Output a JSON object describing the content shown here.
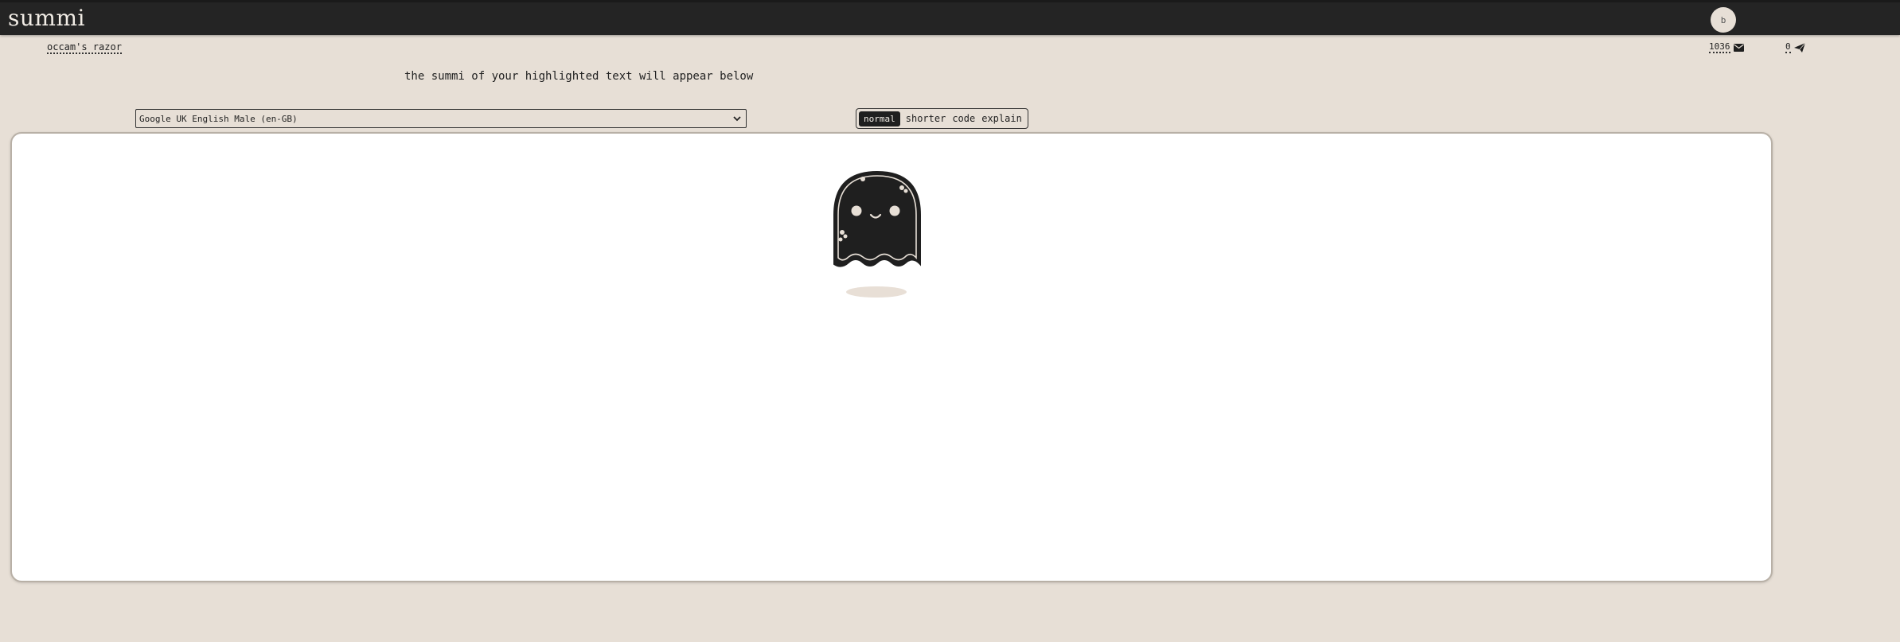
{
  "app": {
    "brand": "summi",
    "avatar_initial": "b"
  },
  "header_links": {
    "occam": "occam's razor",
    "mail_count": "1036",
    "send_count": "0"
  },
  "instructions": "the summi of your highlighted text will appear below",
  "voice": {
    "selected": "Google UK English Male (en-GB)"
  },
  "modes": {
    "items": [
      "normal",
      "shorter",
      "code",
      "explain"
    ],
    "active": "normal"
  },
  "icons": {
    "mail": "envelope-icon",
    "send": "paper-plane-icon",
    "mascot": "ghost-mascot"
  },
  "colors": {
    "background": "#e7dfd6",
    "topbar": "#242424",
    "panel": "#ffffff",
    "accent_dark": "#1f1f1f"
  }
}
